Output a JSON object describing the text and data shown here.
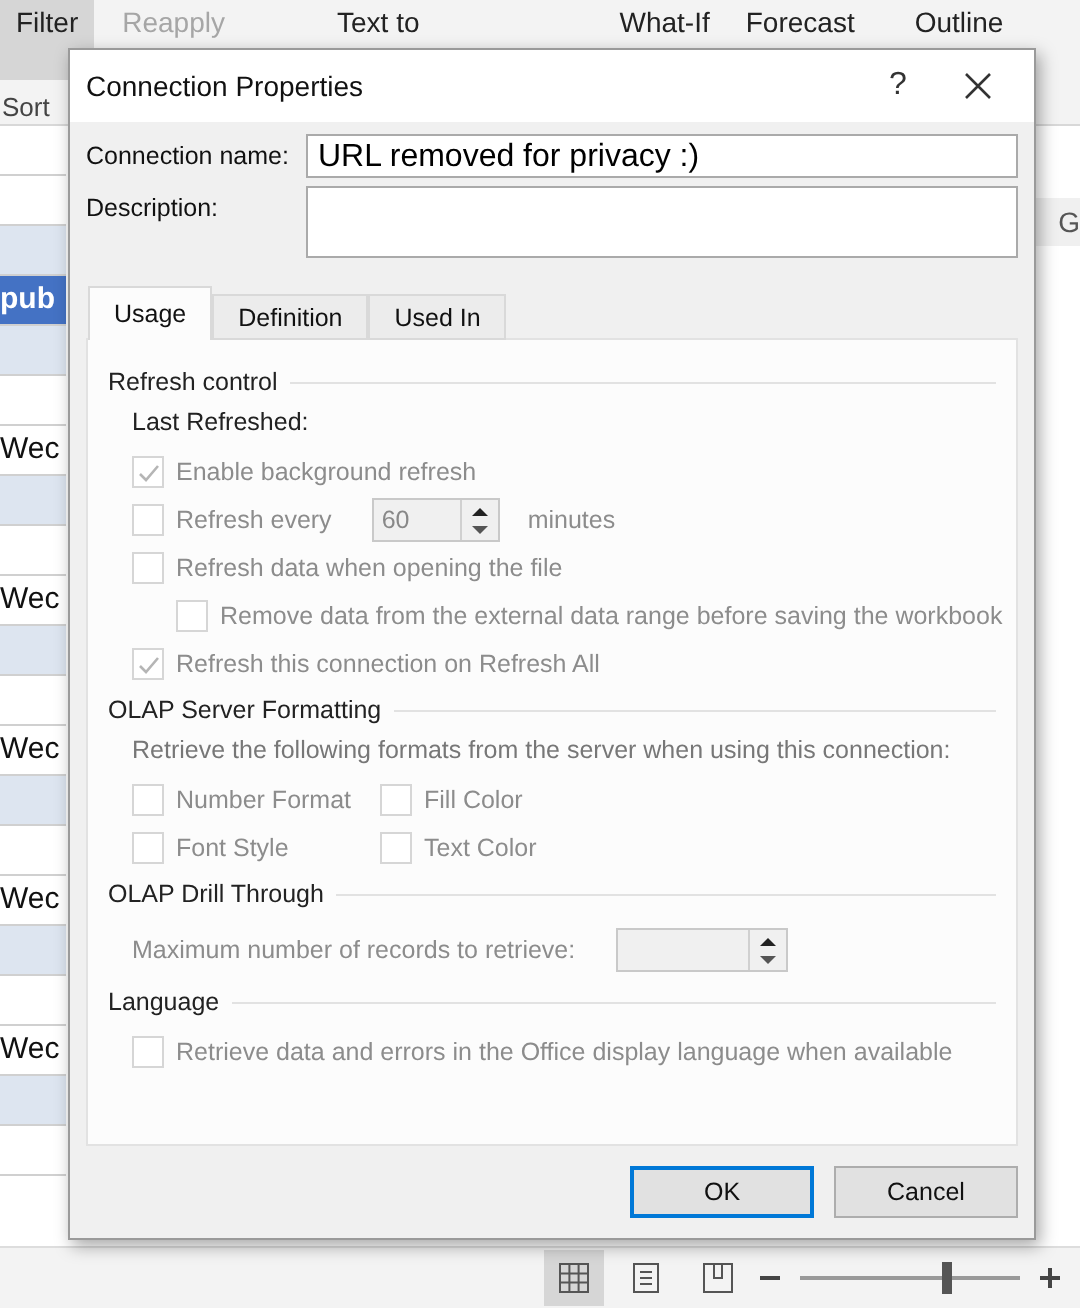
{
  "ribbon": {
    "items": [
      {
        "label": "Filter",
        "selected": true,
        "disabled": false
      },
      {
        "label": "Reapply",
        "selected": false,
        "disabled": true
      },
      {
        "label": "Text to",
        "selected": false,
        "disabled": false
      },
      {
        "label": "What-If",
        "selected": false,
        "disabled": false
      },
      {
        "label": "Forecast",
        "selected": false,
        "disabled": false
      },
      {
        "label": "Outline",
        "selected": false,
        "disabled": false
      }
    ],
    "group_label": "Sort"
  },
  "sheet": {
    "column_header": "G",
    "cells": [
      {
        "kind": "plain"
      },
      {
        "kind": "plain"
      },
      {
        "kind": "shaded"
      },
      {
        "kind": "header",
        "text": "pub"
      },
      {
        "kind": "shaded"
      },
      {
        "kind": "plain"
      },
      {
        "kind": "plain",
        "text": "Wec"
      },
      {
        "kind": "shaded"
      },
      {
        "kind": "plain"
      },
      {
        "kind": "plain",
        "text": "Wec"
      },
      {
        "kind": "shaded"
      },
      {
        "kind": "plain"
      },
      {
        "kind": "plain",
        "text": "Wec"
      },
      {
        "kind": "shaded"
      },
      {
        "kind": "plain"
      },
      {
        "kind": "plain",
        "text": "Wec"
      },
      {
        "kind": "shaded"
      },
      {
        "kind": "plain"
      },
      {
        "kind": "plain",
        "text": "Wec"
      },
      {
        "kind": "shaded"
      },
      {
        "kind": "plain"
      }
    ]
  },
  "dialog": {
    "title": "Connection Properties",
    "help": "?",
    "connection_name": {
      "label": "Connection name:",
      "value": "URL removed for privacy :)"
    },
    "description": {
      "label": "Description:"
    },
    "tabs": [
      {
        "label": "Usage",
        "selected": true
      },
      {
        "label": "Definition",
        "selected": false
      },
      {
        "label": "Used In",
        "selected": false
      }
    ],
    "sections": [
      {
        "title": "Refresh control",
        "note": "Last Refreshed:",
        "items": [
          {
            "kind": "checkbox",
            "label": "Enable background refresh",
            "checked": true,
            "disabled": true
          },
          {
            "kind": "interval",
            "label": "Refresh every",
            "checked": false,
            "disabled": true,
            "value": "60",
            "unit": "minutes"
          },
          {
            "kind": "checkbox",
            "label": "Refresh data when opening the file",
            "checked": false,
            "disabled": true,
            "children": [
              {
                "kind": "checkbox",
                "label": "Remove data from the external data range before saving the workbook",
                "checked": false,
                "disabled": true
              }
            ]
          },
          {
            "kind": "checkbox",
            "label": "Refresh this connection on Refresh All",
            "checked": true,
            "disabled": true
          }
        ]
      },
      {
        "title": "OLAP Server Formatting",
        "note": "Retrieve the following formats from the server when using this connection:",
        "items": [
          {
            "kind": "pair",
            "left": {
              "label": "Number Format",
              "checked": false,
              "disabled": true
            },
            "right": {
              "label": "Fill Color",
              "checked": false,
              "disabled": true
            }
          },
          {
            "kind": "pair",
            "left": {
              "label": "Font Style",
              "checked": false,
              "disabled": true
            },
            "right": {
              "label": "Text Color",
              "checked": false,
              "disabled": true
            }
          }
        ]
      },
      {
        "title": "OLAP Drill Through",
        "items": [
          {
            "kind": "number",
            "label": "Maximum number of records to retrieve:",
            "disabled": true
          }
        ]
      },
      {
        "title": "Language",
        "items": [
          {
            "kind": "checkbox",
            "label": "Retrieve data and errors in the Office display language when available",
            "checked": false,
            "disabled": true
          }
        ]
      }
    ],
    "buttons": [
      {
        "label": "OK",
        "selected": true
      },
      {
        "label": "Cancel",
        "selected": false
      }
    ]
  },
  "status_bar": {
    "views": [
      {
        "kind": "normal",
        "selected": true
      },
      {
        "kind": "layout",
        "selected": false
      },
      {
        "kind": "break",
        "selected": false
      }
    ],
    "zoom": {
      "level": 0.66
    }
  }
}
